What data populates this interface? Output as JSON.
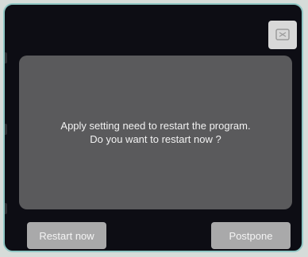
{
  "dialog": {
    "message_line1": "Apply setting need to restart the program.",
    "message_line2": "Do you want to restart now ?",
    "close_icon": "close-icon",
    "restart_label": "Restart now",
    "postpone_label": "Postpone"
  },
  "colors": {
    "dialog_bg": "#0d0d14",
    "dialog_border": "#8fc7c4",
    "message_bg": "#5a5a5c",
    "button_bg": "#a9a9aa",
    "close_bg": "#d8d8d8"
  }
}
